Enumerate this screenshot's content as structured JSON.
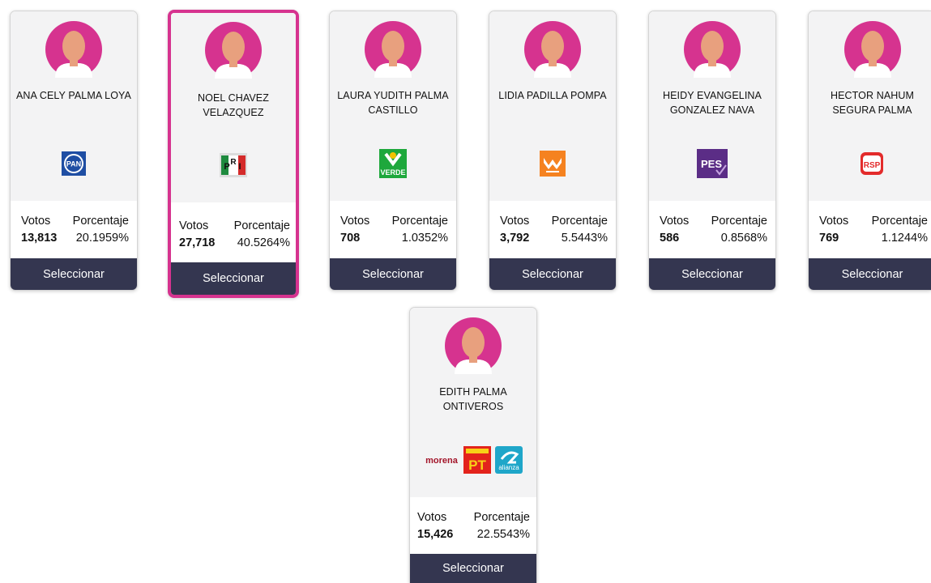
{
  "labels": {
    "votos": "Votos",
    "porcentaje": "Porcentaje",
    "select_button": "Seleccionar"
  },
  "colors": {
    "avatar_bg": "#d6338f",
    "skin": "#e8a07e",
    "button_bg": "#343650",
    "selected_border": "#d6338f"
  },
  "candidates": [
    {
      "name": "ANA CELY PALMA LOYA",
      "votes": "13,813",
      "percentage": "20.1959%",
      "parties": [
        "pan-logo"
      ],
      "selected": false
    },
    {
      "name": "NOEL CHAVEZ VELAZQUEZ",
      "votes": "27,718",
      "percentage": "40.5264%",
      "parties": [
        "pri-logo"
      ],
      "selected": true
    },
    {
      "name": "LAURA YUDITH PALMA CASTILLO",
      "votes": "708",
      "percentage": "1.0352%",
      "parties": [
        "verde-logo"
      ],
      "selected": false
    },
    {
      "name": "LIDIA PADILLA POMPA",
      "votes": "3,792",
      "percentage": "5.5443%",
      "parties": [
        "movimiento-ciudadano-logo"
      ],
      "selected": false
    },
    {
      "name": "HEIDY EVANGELINA GONZALEZ NAVA",
      "votes": "586",
      "percentage": "0.8568%",
      "parties": [
        "pes-logo"
      ],
      "selected": false
    },
    {
      "name": "HECTOR NAHUM SEGURA PALMA",
      "votes": "769",
      "percentage": "1.1244%",
      "parties": [
        "rsp-logo"
      ],
      "selected": false
    },
    {
      "name": "EDITH PALMA ONTIVEROS",
      "votes": "15,426",
      "percentage": "22.5543%",
      "parties": [
        "morena-logo",
        "pt-logo",
        "nueva-alianza-logo"
      ],
      "selected": false
    }
  ],
  "party_text": {
    "pan": "PAN",
    "pri_p": "P",
    "pri_r": "R",
    "pri_i": "I",
    "verde": "VERDE",
    "pes": "PES",
    "rsp": "RSP",
    "morena": "morena",
    "pt": "PT",
    "alianza": "alianza"
  }
}
